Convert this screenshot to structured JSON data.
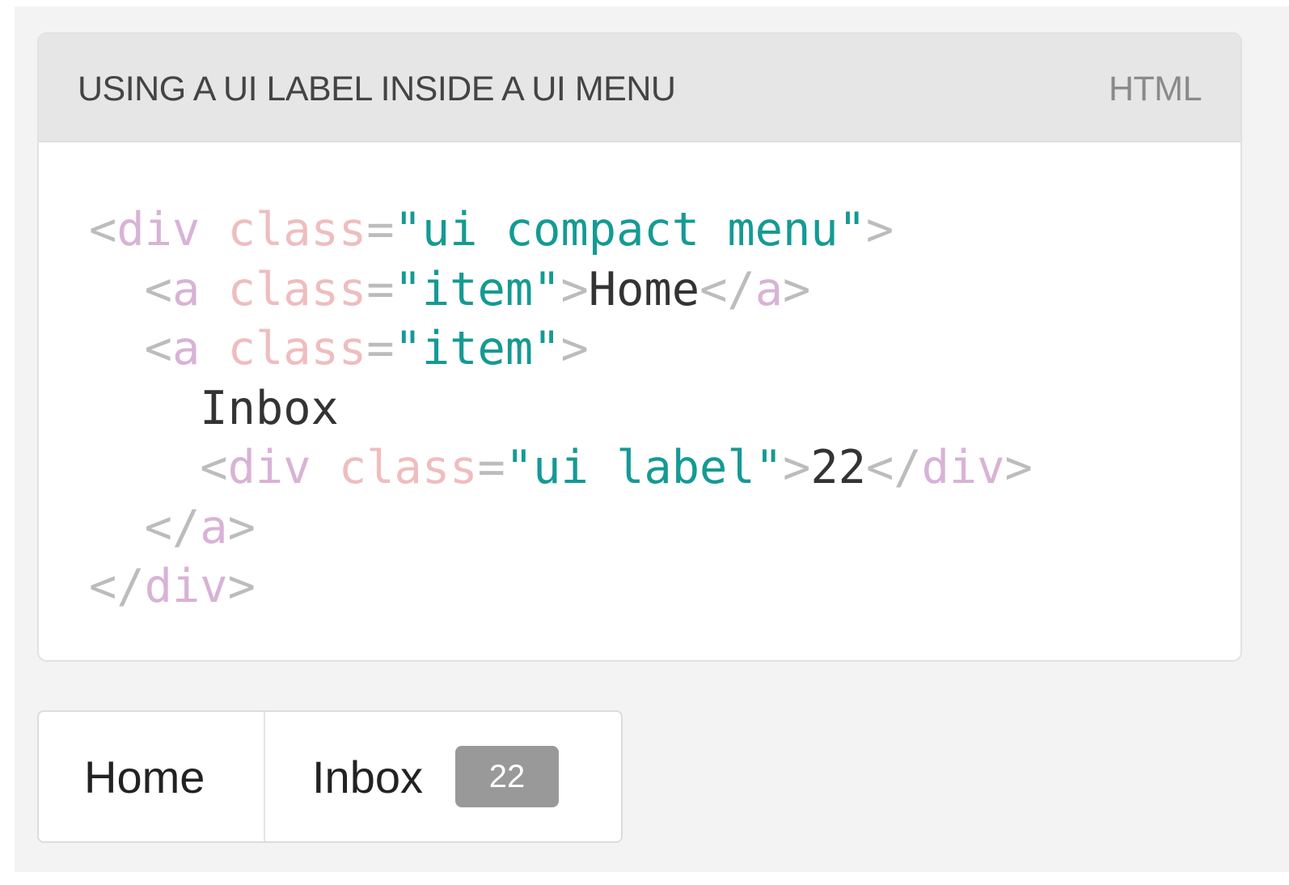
{
  "example": {
    "title": "USING A UI LABEL INSIDE A UI MENU",
    "language": "HTML",
    "code": {
      "line1": {
        "open": "<",
        "tag": "div",
        "attr": "class",
        "eq": "=",
        "value": "\"ui compact menu\"",
        "close": ">"
      },
      "line2": {
        "open": "<",
        "tag": "a",
        "attr": "class",
        "eq": "=",
        "value": "\"item\"",
        "close": ">",
        "text": "Home",
        "end_open": "</",
        "end_tag": "a",
        "end_close": ">"
      },
      "line3": {
        "open": "<",
        "tag": "a",
        "attr": "class",
        "eq": "=",
        "value": "\"item\"",
        "close": ">"
      },
      "line4": {
        "text": "Inbox"
      },
      "line5": {
        "open": "<",
        "tag": "div",
        "attr": "class",
        "eq": "=",
        "value": "\"ui label\"",
        "close": ">",
        "text": "22",
        "end_open": "</",
        "end_tag": "div",
        "end_close": ">"
      },
      "line6": {
        "end_open": "</",
        "end_tag": "a",
        "end_close": ">"
      },
      "line7": {
        "end_open": "</",
        "end_tag": "div",
        "end_close": ">"
      }
    }
  },
  "menu": {
    "items": [
      {
        "label": "Home"
      },
      {
        "label": "Inbox",
        "badge": "22"
      }
    ]
  },
  "colors": {
    "page_background": "#f3f3f3",
    "header_background": "#e6e6e6",
    "code_punctuation": "#bcbcbc",
    "code_tag": "#d8b3d6",
    "code_attribute": "#efbdbf",
    "code_string": "#159a94",
    "code_text": "#333333",
    "label_background": "#999999",
    "label_text": "#ffffff"
  }
}
